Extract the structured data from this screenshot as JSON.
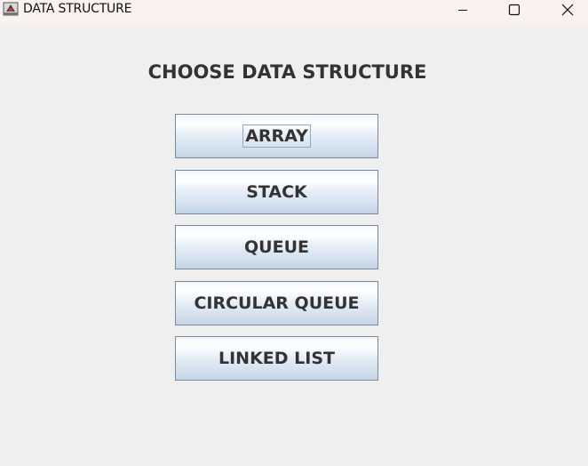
{
  "window": {
    "title": "DATA STRUCTURE",
    "app_icon": "java-app-icon",
    "controls": {
      "minimize_icon": "minimize-icon",
      "maximize_icon": "maximize-icon",
      "close_icon": "close-icon"
    }
  },
  "main": {
    "heading": "CHOOSE DATA STRUCTURE",
    "buttons": [
      {
        "label": "ARRAY",
        "focused": true
      },
      {
        "label": "STACK",
        "focused": false
      },
      {
        "label": "QUEUE",
        "focused": false
      },
      {
        "label": "CIRCULAR QUEUE",
        "focused": false
      },
      {
        "label": "LINKED LIST",
        "focused": false
      }
    ]
  },
  "colors": {
    "window_background": "#efefef",
    "titlebar_background": "#f9f2ee",
    "text": "#333333",
    "button_border": "#7a8a99"
  }
}
